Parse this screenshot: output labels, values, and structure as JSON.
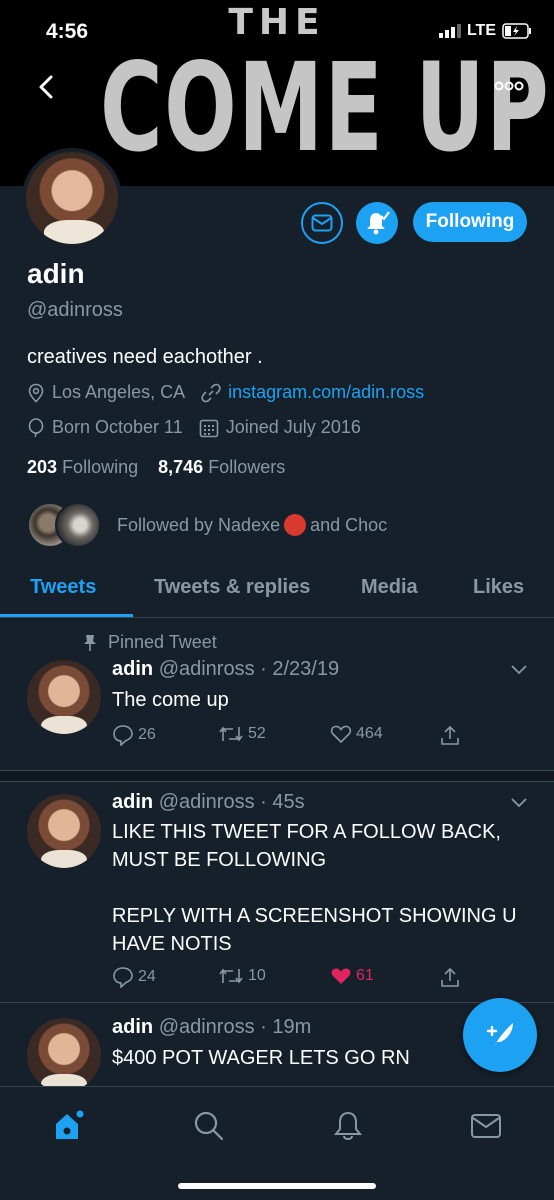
{
  "status_bar": {
    "time": "4:56",
    "network": "LTE"
  },
  "banner": {
    "line1": "THE",
    "line2": "COME UP"
  },
  "profile": {
    "name": "adin",
    "handle": "@adinross",
    "bio": "creatives need eachother .",
    "location": "Los Angeles, CA",
    "website": "instagram.com/adin.ross",
    "birthday": "Born October 11",
    "joined": "Joined July 2016",
    "following_count": "203",
    "following_label": "Following",
    "followers_count": "8,746",
    "followers_label": "Followers",
    "followed_by_prefix": "Followed by Nadexe",
    "followed_by_suffix": "and Choc",
    "follow_button": "Following"
  },
  "tabs": [
    {
      "label": "Tweets",
      "active": true
    },
    {
      "label": "Tweets & replies"
    },
    {
      "label": "Media"
    },
    {
      "label": "Likes"
    }
  ],
  "tweets": [
    {
      "pinned_label": "Pinned Tweet",
      "name": "adin",
      "handle_time": "@adinross · 2/23/19",
      "text": "The come up",
      "replies": "26",
      "retweets": "52",
      "likes": "464",
      "liked": false
    },
    {
      "name": "adin",
      "handle_time": "@adinross · 45s",
      "text": "LIKE THIS TWEET FOR A FOLLOW BACK, MUST BE FOLLOWING\n\nREPLY WITH A SCREENSHOT SHOWING U HAVE NOTIS",
      "replies": "24",
      "retweets": "10",
      "likes": "61",
      "liked": true
    },
    {
      "name": "adin",
      "handle_time": "@adinross · 19m",
      "text": "$400 POT WAGER LETS GO RN"
    }
  ],
  "colors": {
    "accent": "#1da1f2",
    "background": "#15202b",
    "muted": "#8899a6",
    "like": "#e0245e"
  },
  "nav": [
    "home-icon",
    "search-icon",
    "notifications-icon",
    "messages-icon"
  ]
}
